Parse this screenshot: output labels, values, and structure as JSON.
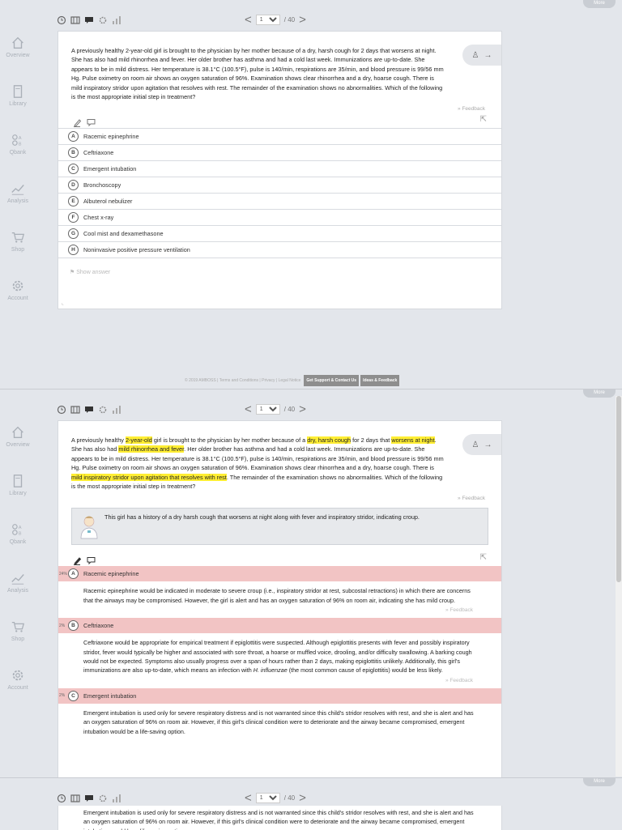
{
  "toolbar": {
    "page_value": "1",
    "page_total": "/ 40",
    "prev": "<",
    "next": ">"
  },
  "sidebar": {
    "items": [
      {
        "label": "Overview",
        "icon": "home-icon"
      },
      {
        "label": "Library",
        "icon": "book-icon"
      },
      {
        "label": "Qbank",
        "icon": "qbank-icon"
      },
      {
        "label": "Analysis",
        "icon": "chart-line-icon"
      },
      {
        "label": "Shop",
        "icon": "cart-icon"
      },
      {
        "label": "Account",
        "icon": "gear-icon"
      }
    ]
  },
  "more_label": "More",
  "question": {
    "segments": [
      {
        "t": "A previously healthy ",
        "hl": false
      },
      {
        "t": "2-year-old",
        "hl": true
      },
      {
        "t": " girl is brought to the physician by her mother because of a ",
        "hl": false
      },
      {
        "t": "dry, harsh cough",
        "hl": true
      },
      {
        "t": " for 2 days that ",
        "hl": false
      },
      {
        "t": "worsens at night",
        "hl": true
      },
      {
        "t": ". She has also had ",
        "hl": false
      },
      {
        "t": "mild rhinorrhea and fever",
        "hl": true
      },
      {
        "t": ". Her older brother has asthma and had a cold last week. Immunizations are up-to-date. She appears to be in mild distress. Her temperature is 38.1°C (100.5°F), pulse is 140/min, respirations are 35/min, and blood pressure is 99/56 mm Hg. Pulse oximetry on room air shows an oxygen saturation of 96%. Examination shows clear rhinorrhea and a dry, hoarse cough. There is ",
        "hl": false
      },
      {
        "t": "mild inspiratory stridor upon agitation that resolves with rest",
        "hl": true
      },
      {
        "t": ". The remainder of the examination shows no abnormalities. Which of the following is the most appropriate initial step in treatment?",
        "hl": false
      }
    ],
    "feedback_label": "» Feedback"
  },
  "options": [
    {
      "letter": "A",
      "text": "Racemic epinephrine"
    },
    {
      "letter": "B",
      "text": "Ceftriaxone"
    },
    {
      "letter": "C",
      "text": "Emergent intubation"
    },
    {
      "letter": "D",
      "text": "Bronchoscopy"
    },
    {
      "letter": "E",
      "text": "Albuterol nebulizer"
    },
    {
      "letter": "F",
      "text": "Chest x-ray"
    },
    {
      "letter": "G",
      "text": "Cool mist and dexamethasone"
    },
    {
      "letter": "H",
      "text": "Noninvasive positive pressure ventilation"
    }
  ],
  "show_answer_label": "Show answer",
  "footer": {
    "text": "© 2019 AMBOSS | Terms and Conditions | Privacy | Legal Notice",
    "support": "Get Support & Contact Us",
    "ideas": "Ideas & Feedback"
  },
  "explanation": {
    "summary": "This girl has a history of a dry harsh cough that worsens at night along with fever and inspiratory stridor, indicating croup."
  },
  "answers": [
    {
      "letter": "A",
      "pct": "24%",
      "text": "Racemic epinephrine",
      "body": "Racemic epinephrine would be indicated in moderate to severe croup (i.e., inspiratory stridor at rest, subcostal retractions) in which there are concerns that the airways may be compromised. However, the girl is alert and has an oxygen saturation of 96% on room air, indicating she has mild croup."
    },
    {
      "letter": "B",
      "pct": "2%",
      "text": "Ceftriaxone",
      "body_pre": "Ceftriaxone would be appropriate for empirical treatment if epiglottitis were suspected. Although epiglottitis presents with fever and possibly inspiratory stridor, fever would typically be higher and associated with sore throat, a hoarse or muffled voice, drooling, and/or difficulty swallowing. A barking cough would not be expected. Symptoms also usually progress over a span of hours rather than 2 days, making epiglottitis unlikely. Additionally, this girl's immunizations are also up-to-date, which means an infection with ",
      "body_italic": "H. influenzae",
      "body_post": " (the most common cause of epiglottitis) would be less likely."
    },
    {
      "letter": "C",
      "pct": "2%",
      "text": "Emergent intubation",
      "body": "Emergent intubation is used only for severe respiratory distress and is not warranted since this child's stridor resolves with rest, and she is alert and has an oxygen saturation of 96% on room air. However, if this girl's clinical condition were to deteriorate and the airway became compromised, emergent intubation would be a life-saving option."
    }
  ]
}
